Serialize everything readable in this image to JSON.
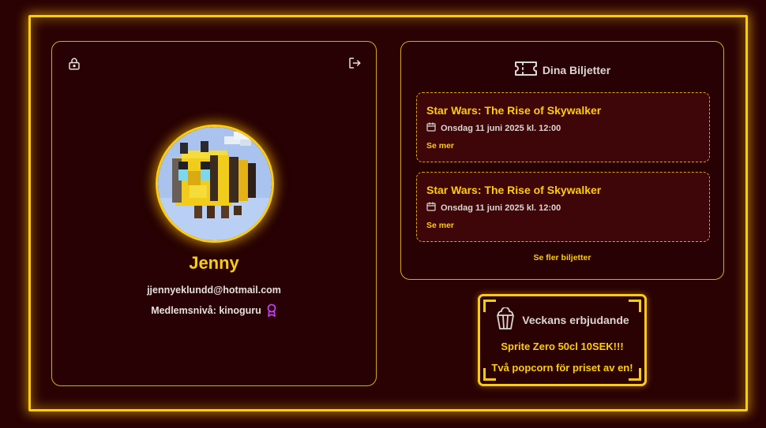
{
  "profile": {
    "name": "Jenny",
    "email": "jjennyeklundd@hotmail.com",
    "membership": "Medlemsnivå: kinoguru",
    "icons": {
      "lock": "lock-icon",
      "logout": "logout-icon",
      "award": "award-icon"
    }
  },
  "tickets": {
    "header": "Dina Biljetter",
    "items": [
      {
        "title": "Star Wars: The Rise of Skywalker",
        "date": "Onsdag 11 juni 2025 kl. 12:00",
        "link": "Se mer"
      },
      {
        "title": "Star Wars: The Rise of Skywalker",
        "date": "Onsdag 11 juni 2025 kl. 12:00",
        "link": "Se mer"
      }
    ],
    "more_link": "Se fler biljetter"
  },
  "offer": {
    "header": "Veckans erbjudande",
    "lines": [
      "Sprite Zero 50cl 10SEK!!!",
      "Två popcorn för priset av en!"
    ]
  },
  "colors": {
    "background": "#2a0204",
    "accent": "#ffcc11",
    "card": "#270103",
    "ticket_bg": "#3e0608",
    "award": "#c23ef0"
  }
}
